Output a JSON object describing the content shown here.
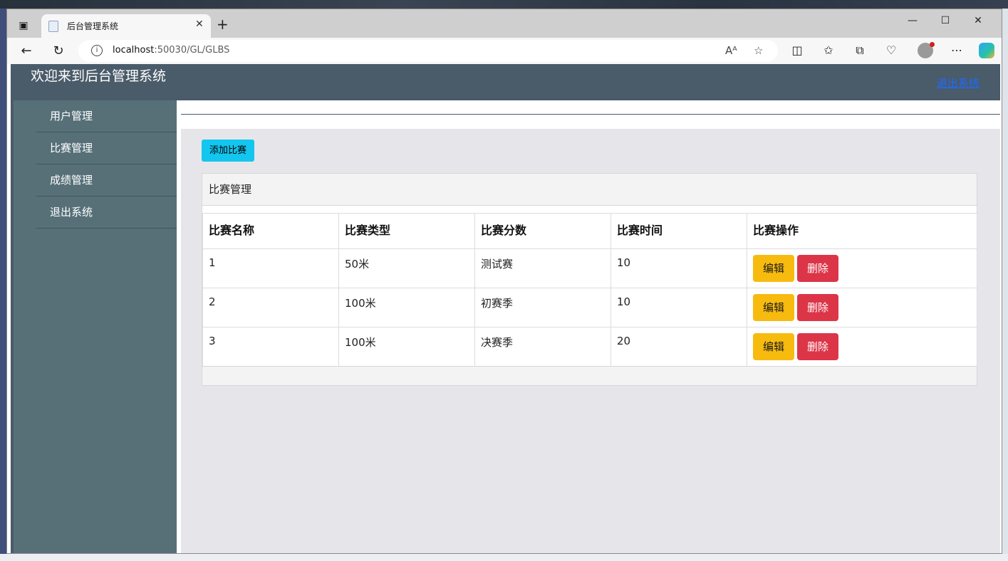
{
  "browser": {
    "tab_title": "后台管理系统",
    "url_host": "localhost",
    "url_path": ":50030/GL/GLBS",
    "icons": [
      "tab-actions-icon",
      "page-icon",
      "close-icon",
      "plus-icon",
      "minimize-icon",
      "maximize-icon",
      "close-window-icon",
      "back-arrow-icon",
      "refresh-icon",
      "info-icon",
      "read-aloud-icon",
      "star-icon",
      "split-screen-icon",
      "favorites-icon",
      "collections-icon",
      "browser-essentials-icon",
      "profile-icon",
      "more-icon",
      "copilot-icon"
    ]
  },
  "header": {
    "welcome": "欢迎来到后台管理系统",
    "logout": "退出系统"
  },
  "sidebar": {
    "items": [
      {
        "label": "用户管理"
      },
      {
        "label": "比赛管理"
      },
      {
        "label": "成绩管理"
      },
      {
        "label": "退出系统"
      }
    ]
  },
  "main": {
    "add_button": "添加比赛",
    "card_title": "比赛管理",
    "columns": [
      "比赛名称",
      "比赛类型",
      "比赛分数",
      "比赛时间",
      "比赛操作"
    ],
    "rows": [
      {
        "name": "1",
        "type": "50米",
        "score": "测试赛",
        "time": "10"
      },
      {
        "name": "2",
        "type": "100米",
        "score": "初赛季",
        "time": "10"
      },
      {
        "name": "3",
        "type": "100米",
        "score": "决赛季",
        "time": "20"
      }
    ],
    "edit_label": "编辑",
    "delete_label": "删除"
  },
  "colors": {
    "header_bg": "#4a5b6a",
    "sidebar_bg": "#577078",
    "add_button": "#13c6ef",
    "edit_button": "#f7bb10",
    "delete_button": "#dc3548"
  }
}
